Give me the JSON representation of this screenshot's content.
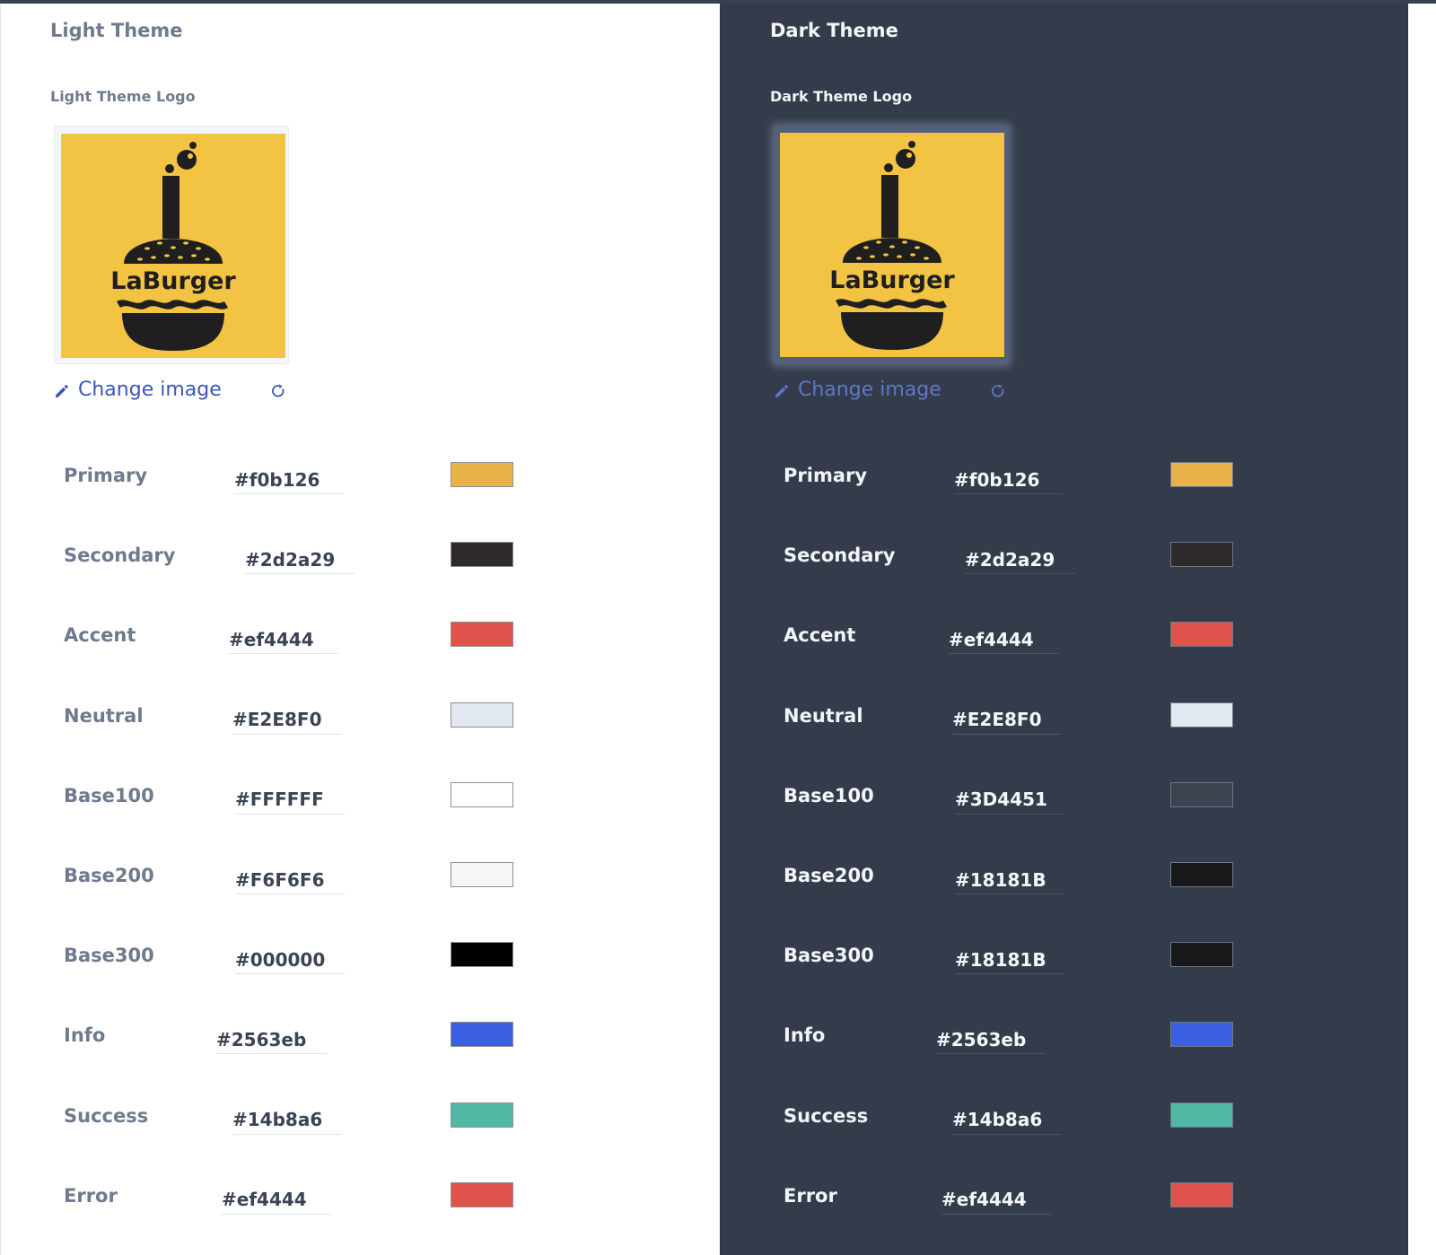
{
  "light": {
    "title": "Light Theme",
    "logo_label": "Light Theme Logo",
    "logo_text": "LaBurger",
    "change_image_label": "Change image",
    "colors": [
      {
        "label": "Primary",
        "value": "#f0b126",
        "swatch": "#e8b44a"
      },
      {
        "label": "Secondary",
        "value": "#2d2a29",
        "swatch": "#2d2a29"
      },
      {
        "label": "Accent",
        "value": "#ef4444",
        "swatch": "#e0524c"
      },
      {
        "label": "Neutral",
        "value": "#E2E8F0",
        "swatch": "#e2e8f0"
      },
      {
        "label": "Base100",
        "value": "#FFFFFF",
        "swatch": "#ffffff"
      },
      {
        "label": "Base200",
        "value": "#F6F6F6",
        "swatch": "#f6f6f6"
      },
      {
        "label": "Base300",
        "value": "#000000",
        "swatch": "#000000"
      },
      {
        "label": "Info",
        "value": "#2563eb",
        "swatch": "#3b5fe3"
      },
      {
        "label": "Success",
        "value": "#14b8a6",
        "swatch": "#52b7a4"
      },
      {
        "label": "Error",
        "value": "#ef4444",
        "swatch": "#e0524c"
      }
    ]
  },
  "dark": {
    "title": "Dark Theme",
    "logo_label": "Dark Theme Logo",
    "logo_text": "LaBurger",
    "change_image_label": "Change image",
    "colors": [
      {
        "label": "Primary",
        "value": "#f0b126",
        "swatch": "#e8b44a"
      },
      {
        "label": "Secondary",
        "value": "#2d2a29",
        "swatch": "#2d2a29"
      },
      {
        "label": "Accent",
        "value": "#ef4444",
        "swatch": "#e0524c"
      },
      {
        "label": "Neutral",
        "value": "#E2E8F0",
        "swatch": "#e2e8f0"
      },
      {
        "label": "Base100",
        "value": "#3D4451",
        "swatch": "#3d4451"
      },
      {
        "label": "Base200",
        "value": "#18181B",
        "swatch": "#18181b"
      },
      {
        "label": "Base300",
        "value": "#18181B",
        "swatch": "#18181b"
      },
      {
        "label": "Info",
        "value": "#2563eb",
        "swatch": "#3b5fe3"
      },
      {
        "label": "Success",
        "value": "#14b8a6",
        "swatch": "#52b7a4"
      },
      {
        "label": "Error",
        "value": "#ef4444",
        "swatch": "#e0524c"
      }
    ]
  },
  "logo_colors": {
    "background": "#f3c343",
    "ink": "#1f1f1f"
  },
  "icons": {
    "edit": "pencil-icon",
    "reset": "refresh-icon"
  }
}
